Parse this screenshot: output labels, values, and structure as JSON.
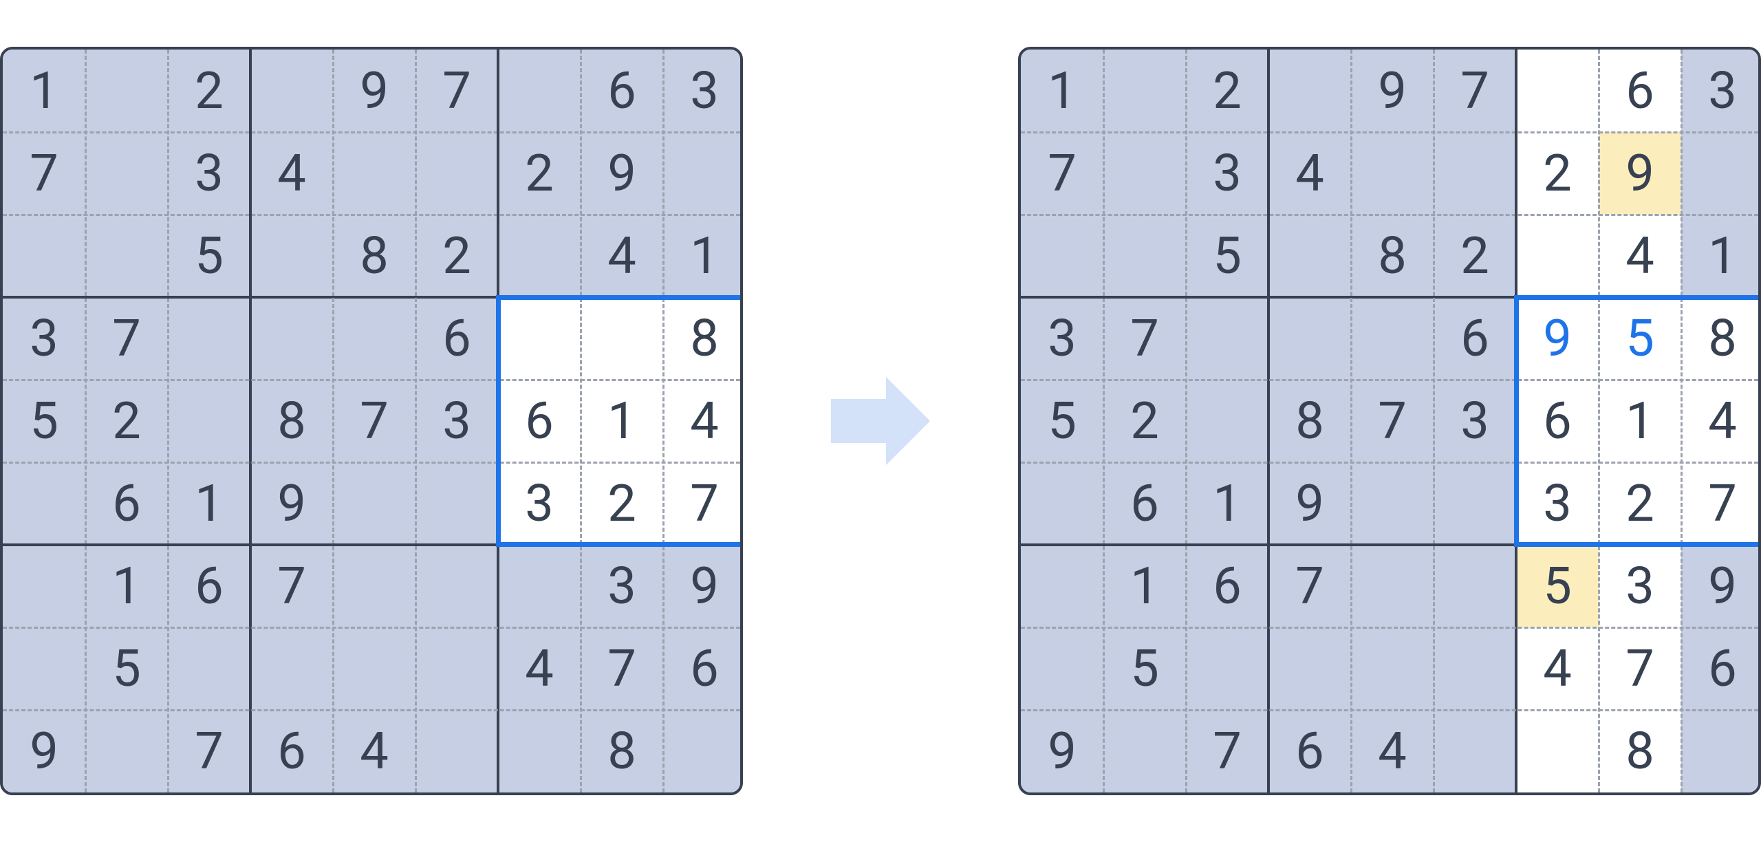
{
  "colors": {
    "cell_text": "#374151",
    "solved_text": "#1f73e8",
    "shade_bg": "#c6cfe3",
    "highlight_bg": "#fbeebc",
    "grid_thick": "#374151",
    "grid_thin_dash": "#9ca3af",
    "box_outline": "#1f73e8",
    "arrow_fill": "#d3e1f9"
  },
  "left_board": {
    "values": [
      [
        "1",
        "",
        "2",
        "",
        "9",
        "7",
        "",
        "6",
        "3"
      ],
      [
        "7",
        "",
        "3",
        "4",
        "",
        "",
        "2",
        "9",
        ""
      ],
      [
        "",
        "",
        "5",
        "",
        "8",
        "2",
        "",
        "4",
        "1"
      ],
      [
        "3",
        "7",
        "",
        "",
        "",
        "6",
        "",
        "",
        "8"
      ],
      [
        "5",
        "2",
        "",
        "8",
        "7",
        "3",
        "6",
        "1",
        "4"
      ],
      [
        "",
        "6",
        "1",
        "9",
        "",
        "",
        "3",
        "2",
        "7"
      ],
      [
        "",
        "1",
        "6",
        "7",
        "",
        "",
        "",
        "3",
        "9"
      ],
      [
        "",
        "5",
        "",
        "",
        "",
        "",
        "4",
        "7",
        "6"
      ],
      [
        "9",
        "",
        "7",
        "6",
        "4",
        "",
        "",
        "8",
        ""
      ]
    ],
    "shaded": [
      [
        1,
        1,
        1,
        1,
        1,
        1,
        1,
        1,
        1
      ],
      [
        1,
        1,
        1,
        1,
        1,
        1,
        1,
        1,
        1
      ],
      [
        1,
        1,
        1,
        1,
        1,
        1,
        1,
        1,
        1
      ],
      [
        1,
        1,
        1,
        1,
        1,
        1,
        0,
        0,
        0
      ],
      [
        1,
        1,
        1,
        1,
        1,
        1,
        0,
        0,
        0
      ],
      [
        1,
        1,
        1,
        1,
        1,
        1,
        0,
        0,
        0
      ],
      [
        1,
        1,
        1,
        1,
        1,
        1,
        1,
        1,
        1
      ],
      [
        1,
        1,
        1,
        1,
        1,
        1,
        1,
        1,
        1
      ],
      [
        1,
        1,
        1,
        1,
        1,
        1,
        1,
        1,
        1
      ]
    ],
    "highlighted": [
      [
        0,
        0,
        0,
        0,
        0,
        0,
        0,
        0,
        0
      ],
      [
        0,
        0,
        0,
        0,
        0,
        0,
        0,
        0,
        0
      ],
      [
        0,
        0,
        0,
        0,
        0,
        0,
        0,
        0,
        0
      ],
      [
        0,
        0,
        0,
        0,
        0,
        0,
        0,
        0,
        0
      ],
      [
        0,
        0,
        0,
        0,
        0,
        0,
        0,
        0,
        0
      ],
      [
        0,
        0,
        0,
        0,
        0,
        0,
        0,
        0,
        0
      ],
      [
        0,
        0,
        0,
        0,
        0,
        0,
        0,
        0,
        0
      ],
      [
        0,
        0,
        0,
        0,
        0,
        0,
        0,
        0,
        0
      ],
      [
        0,
        0,
        0,
        0,
        0,
        0,
        0,
        0,
        0
      ]
    ],
    "solved": [
      [
        0,
        0,
        0,
        0,
        0,
        0,
        0,
        0,
        0
      ],
      [
        0,
        0,
        0,
        0,
        0,
        0,
        0,
        0,
        0
      ],
      [
        0,
        0,
        0,
        0,
        0,
        0,
        0,
        0,
        0
      ],
      [
        0,
        0,
        0,
        0,
        0,
        0,
        0,
        0,
        0
      ],
      [
        0,
        0,
        0,
        0,
        0,
        0,
        0,
        0,
        0
      ],
      [
        0,
        0,
        0,
        0,
        0,
        0,
        0,
        0,
        0
      ],
      [
        0,
        0,
        0,
        0,
        0,
        0,
        0,
        0,
        0
      ],
      [
        0,
        0,
        0,
        0,
        0,
        0,
        0,
        0,
        0
      ],
      [
        0,
        0,
        0,
        0,
        0,
        0,
        0,
        0,
        0
      ]
    ],
    "box_outline": {
      "row": 3,
      "col": 6,
      "rows": 3,
      "cols": 3
    }
  },
  "right_board": {
    "values": [
      [
        "1",
        "",
        "2",
        "",
        "9",
        "7",
        "",
        "6",
        "3"
      ],
      [
        "7",
        "",
        "3",
        "4",
        "",
        "",
        "2",
        "9",
        ""
      ],
      [
        "",
        "",
        "5",
        "",
        "8",
        "2",
        "",
        "4",
        "1"
      ],
      [
        "3",
        "7",
        "",
        "",
        "",
        "6",
        "9",
        "5",
        "8"
      ],
      [
        "5",
        "2",
        "",
        "8",
        "7",
        "3",
        "6",
        "1",
        "4"
      ],
      [
        "",
        "6",
        "1",
        "9",
        "",
        "",
        "3",
        "2",
        "7"
      ],
      [
        "",
        "1",
        "6",
        "7",
        "",
        "",
        "5",
        "3",
        "9"
      ],
      [
        "",
        "5",
        "",
        "",
        "",
        "",
        "4",
        "7",
        "6"
      ],
      [
        "9",
        "",
        "7",
        "6",
        "4",
        "",
        "",
        "8",
        ""
      ]
    ],
    "shaded": [
      [
        1,
        1,
        1,
        1,
        1,
        1,
        0,
        0,
        1
      ],
      [
        1,
        1,
        1,
        1,
        1,
        1,
        0,
        0,
        1
      ],
      [
        1,
        1,
        1,
        1,
        1,
        1,
        0,
        0,
        1
      ],
      [
        1,
        1,
        1,
        1,
        1,
        1,
        0,
        0,
        0
      ],
      [
        1,
        1,
        1,
        1,
        1,
        1,
        0,
        0,
        0
      ],
      [
        1,
        1,
        1,
        1,
        1,
        1,
        0,
        0,
        0
      ],
      [
        1,
        1,
        1,
        1,
        1,
        1,
        0,
        0,
        1
      ],
      [
        1,
        1,
        1,
        1,
        1,
        1,
        0,
        0,
        1
      ],
      [
        1,
        1,
        1,
        1,
        1,
        1,
        0,
        0,
        1
      ]
    ],
    "highlighted": [
      [
        0,
        0,
        0,
        0,
        0,
        0,
        0,
        0,
        0
      ],
      [
        0,
        0,
        0,
        0,
        0,
        0,
        0,
        1,
        0
      ],
      [
        0,
        0,
        0,
        0,
        0,
        0,
        0,
        0,
        0
      ],
      [
        0,
        0,
        0,
        0,
        0,
        0,
        0,
        0,
        0
      ],
      [
        0,
        0,
        0,
        0,
        0,
        0,
        0,
        0,
        0
      ],
      [
        0,
        0,
        0,
        0,
        0,
        0,
        0,
        0,
        0
      ],
      [
        0,
        0,
        0,
        0,
        0,
        0,
        1,
        0,
        0
      ],
      [
        0,
        0,
        0,
        0,
        0,
        0,
        0,
        0,
        0
      ],
      [
        0,
        0,
        0,
        0,
        0,
        0,
        0,
        0,
        0
      ]
    ],
    "solved": [
      [
        0,
        0,
        0,
        0,
        0,
        0,
        0,
        0,
        0
      ],
      [
        0,
        0,
        0,
        0,
        0,
        0,
        0,
        0,
        0
      ],
      [
        0,
        0,
        0,
        0,
        0,
        0,
        0,
        0,
        0
      ],
      [
        0,
        0,
        0,
        0,
        0,
        0,
        1,
        1,
        0
      ],
      [
        0,
        0,
        0,
        0,
        0,
        0,
        0,
        0,
        0
      ],
      [
        0,
        0,
        0,
        0,
        0,
        0,
        0,
        0,
        0
      ],
      [
        0,
        0,
        0,
        0,
        0,
        0,
        0,
        0,
        0
      ],
      [
        0,
        0,
        0,
        0,
        0,
        0,
        0,
        0,
        0
      ],
      [
        0,
        0,
        0,
        0,
        0,
        0,
        0,
        0,
        0
      ]
    ],
    "box_outline": {
      "row": 3,
      "col": 6,
      "rows": 3,
      "cols": 3
    }
  }
}
